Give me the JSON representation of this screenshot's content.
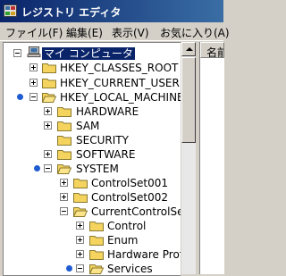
{
  "window": {
    "title": "レジストリ エディタ"
  },
  "menu": [
    {
      "label": "ファイル(F)"
    },
    {
      "label": "編集(E)"
    },
    {
      "label": "表示(V)"
    },
    {
      "label": "お気に入り(A)"
    }
  ],
  "right_pane": {
    "column_header": "名前"
  },
  "tree": {
    "root": {
      "label": "マイ コンピュータ",
      "selected": true
    },
    "nodes": [
      {
        "label": "HKEY_CLASSES_ROOT",
        "expander": "plus"
      },
      {
        "label": "HKEY_CURRENT_USER",
        "expander": "plus"
      },
      {
        "label": "HKEY_LOCAL_MACHINE",
        "expander": "minus",
        "marked": true
      },
      {
        "label": "HARDWARE",
        "expander": "plus"
      },
      {
        "label": "SAM",
        "expander": "plus"
      },
      {
        "label": "SECURITY",
        "expander": "none"
      },
      {
        "label": "SOFTWARE",
        "expander": "plus"
      },
      {
        "label": "SYSTEM",
        "expander": "minus",
        "marked": true
      },
      {
        "label": "ControlSet001",
        "expander": "plus"
      },
      {
        "label": "ControlSet002",
        "expander": "plus"
      },
      {
        "label": "CurrentControlSet",
        "expander": "minus"
      },
      {
        "label": "Control",
        "expander": "plus"
      },
      {
        "label": "Enum",
        "expander": "plus"
      },
      {
        "label": "Hardware Profi",
        "expander": "plus"
      },
      {
        "label": "Services",
        "expander": "minus",
        "marked": true
      }
    ]
  },
  "colors": {
    "title_bar": "#0a246a",
    "selection": "#0a246a",
    "folder": "#f4d35e",
    "marker": "#1f5bd1"
  },
  "icons": {
    "app": "registry-editor-icon",
    "computer": "computer-icon",
    "folder": "folder-icon"
  }
}
